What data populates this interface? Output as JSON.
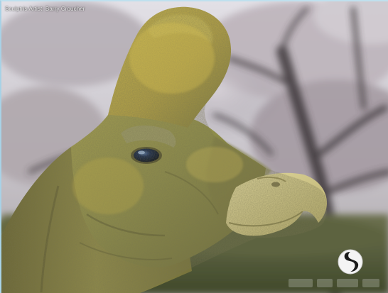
{
  "image": {
    "caption": "Sculptris Artist: Barry Croucher",
    "logo_icon": "sculptris-logo-icon"
  },
  "colors": {
    "sky": "#c9c5cb",
    "foliage": "#9a8f98",
    "tree_bark": "#3a3537",
    "ground": "#56603c",
    "skin_light": "#c4b15a",
    "skin_mid": "#8f8a48",
    "skin_dark": "#5c5a34",
    "beak": "#d8cf8f",
    "eye": "#0c1730",
    "frame_border": "#a8d2e6"
  }
}
